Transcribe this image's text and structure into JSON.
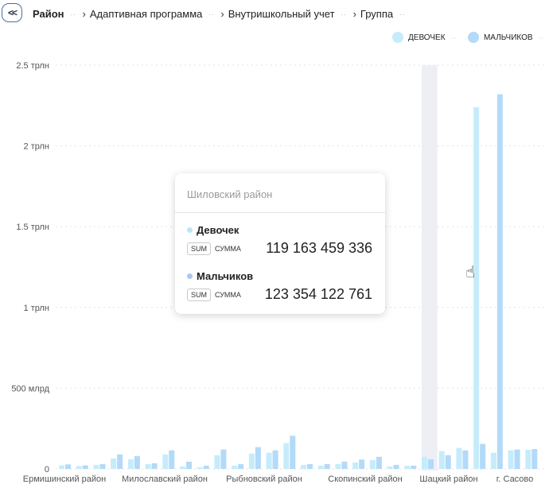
{
  "breadcrumb": {
    "back_label": "<<",
    "items": [
      "Район",
      "Адаптивная программа",
      "Внутришкольный учет",
      "Группа"
    ]
  },
  "legend": {
    "items": [
      {
        "label": "ДЕВОЧЕК",
        "color": "#c6ecfb"
      },
      {
        "label": "МАЛЬЧИКОВ",
        "color": "#b3daf8"
      }
    ]
  },
  "tooltip": {
    "title": "Шиловский район",
    "rows": [
      {
        "name": "Девочек",
        "badge": "SUM",
        "agg": "СУММА",
        "value": "119 163 459 336",
        "color": "#b9e6f8"
      },
      {
        "name": "Мальчиков",
        "badge": "SUM",
        "agg": "СУММА",
        "value": "123 354 122 761",
        "color": "#a9c9ec"
      }
    ]
  },
  "cursor": {
    "icon": "hand-pointer-icon"
  },
  "chart_data": {
    "type": "bar",
    "y_ticks": [
      "0",
      "500 млрд",
      "1 трлн",
      "1.5 трлн",
      "2 трлн",
      "2.5 трлн"
    ],
    "ylim": [
      0,
      2500
    ],
    "y_unit": "млрд",
    "x_tick_labels": [
      "Ермишинский район",
      "Милославский район",
      "Рыбновский район",
      "Скопинский район",
      "Шацкий район",
      "г. Сасово"
    ],
    "highlighted_index": 27,
    "grid": true,
    "legend_position": "top-right",
    "series": [
      {
        "name": "ДЕВОЧЕК",
        "color": "#c6ecfb",
        "values": [
          22,
          18,
          25,
          65,
          60,
          30,
          90,
          15,
          10,
          85,
          20,
          95,
          100,
          160,
          25,
          20,
          30,
          40,
          55,
          15,
          20,
          75,
          110,
          130,
          2240,
          100,
          115,
          119
        ]
      },
      {
        "name": "МАЛЬЧИКОВ",
        "color": "#b3daf8",
        "values": [
          28,
          22,
          30,
          90,
          80,
          35,
          115,
          45,
          20,
          120,
          30,
          135,
          115,
          205,
          30,
          30,
          45,
          58,
          75,
          25,
          20,
          60,
          85,
          115,
          155,
          2320,
          120,
          123
        ]
      }
    ]
  }
}
